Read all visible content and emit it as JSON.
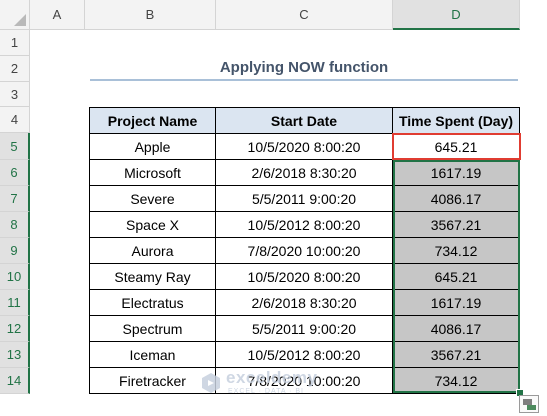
{
  "sheet": {
    "columns": [
      "A",
      "B",
      "C",
      "D"
    ],
    "active_column": "D",
    "rows": [
      "1",
      "2",
      "3",
      "4",
      "5",
      "6",
      "7",
      "8",
      "9",
      "10",
      "11",
      "12",
      "13",
      "14"
    ]
  },
  "title": "Applying NOW function",
  "table": {
    "headers": [
      "Project Name",
      "Start Date",
      "Time Spent (Day)"
    ],
    "rows": [
      {
        "project": "Apple",
        "start": "10/5/2020 8:00:20",
        "time": "645.21"
      },
      {
        "project": "Microsoft",
        "start": "2/6/2018 8:30:20",
        "time": "1617.19"
      },
      {
        "project": "Severe",
        "start": "5/5/2011 9:00:20",
        "time": "4086.17"
      },
      {
        "project": "Space X",
        "start": "10/5/2012 8:00:20",
        "time": "3567.21"
      },
      {
        "project": "Aurora",
        "start": "7/8/2020 10:00:20",
        "time": "734.12"
      },
      {
        "project": "Steamy Ray",
        "start": "10/5/2020 8:00:20",
        "time": "645.21"
      },
      {
        "project": "Electratus",
        "start": "2/6/2018 8:30:20",
        "time": "1617.19"
      },
      {
        "project": "Spectrum",
        "start": "5/5/2011 9:00:20",
        "time": "4086.17"
      },
      {
        "project": "Iceman",
        "start": "10/5/2012 8:00:20",
        "time": "3567.21"
      },
      {
        "project": "Firetracker",
        "start": "7/8/2020 10:00:20",
        "time": "734.12"
      }
    ]
  },
  "colors": {
    "header_fill": "#dbe5f1",
    "selected_fill": "#c6c6c6",
    "selection_border": "#217346",
    "highlight_border": "#e03c31"
  },
  "watermark": {
    "name": "exceldemy",
    "tagline": "EXCEL · DATA · BI"
  }
}
